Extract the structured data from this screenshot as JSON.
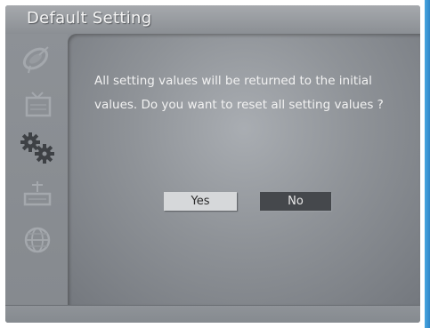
{
  "window": {
    "title": "Default Setting"
  },
  "dialog": {
    "message": "All setting values will be returned to the initial values. Do you want to reset all setting values ?",
    "yes_label": "Yes",
    "no_label": "No",
    "selected": "Yes"
  },
  "sidebar": {
    "items": [
      {
        "icon": "satellite-dish-icon"
      },
      {
        "icon": "tv-channel-icon"
      },
      {
        "icon": "settings-gears-icon",
        "selected": true
      },
      {
        "icon": "antenna-setup-icon"
      },
      {
        "icon": "globe-language-icon"
      }
    ]
  },
  "colors": {
    "frame": "#7f8388",
    "title_text": "#f4f4f4",
    "button_selected": "#d6d8da",
    "button_unselected": "#45484c",
    "accent": "#48a6e0"
  }
}
